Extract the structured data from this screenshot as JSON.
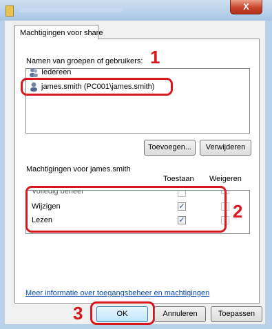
{
  "window": {
    "close_label": "X"
  },
  "tab": {
    "label": "Machtigingen voor share"
  },
  "groups": {
    "heading": "Namen van groepen of gebruikers:",
    "items": [
      {
        "label": "Iedereen"
      },
      {
        "label": "james.smith (PC001\\james.smith)",
        "selected": true
      }
    ],
    "add_label": "Toevoegen...",
    "remove_label": "Verwijderen"
  },
  "permissions": {
    "heading": "Machtigingen voor james.smith",
    "allow_header": "Toestaan",
    "deny_header": "Weigeren",
    "rows": [
      {
        "label": "Volledig beheer",
        "allow": false,
        "deny": false
      },
      {
        "label": "Wijzigen",
        "allow": true,
        "deny": false
      },
      {
        "label": "Lezen",
        "allow": true,
        "deny": false
      }
    ]
  },
  "info_link": "Meer informatie over toegangsbeheer en machtigingen",
  "buttons": {
    "ok": "OK",
    "cancel": "Annuleren",
    "apply": "Toepassen"
  },
  "callouts": [
    "1",
    "2",
    "3"
  ],
  "colors": {
    "highlight": "#d9171e",
    "link": "#0b4cb4"
  }
}
